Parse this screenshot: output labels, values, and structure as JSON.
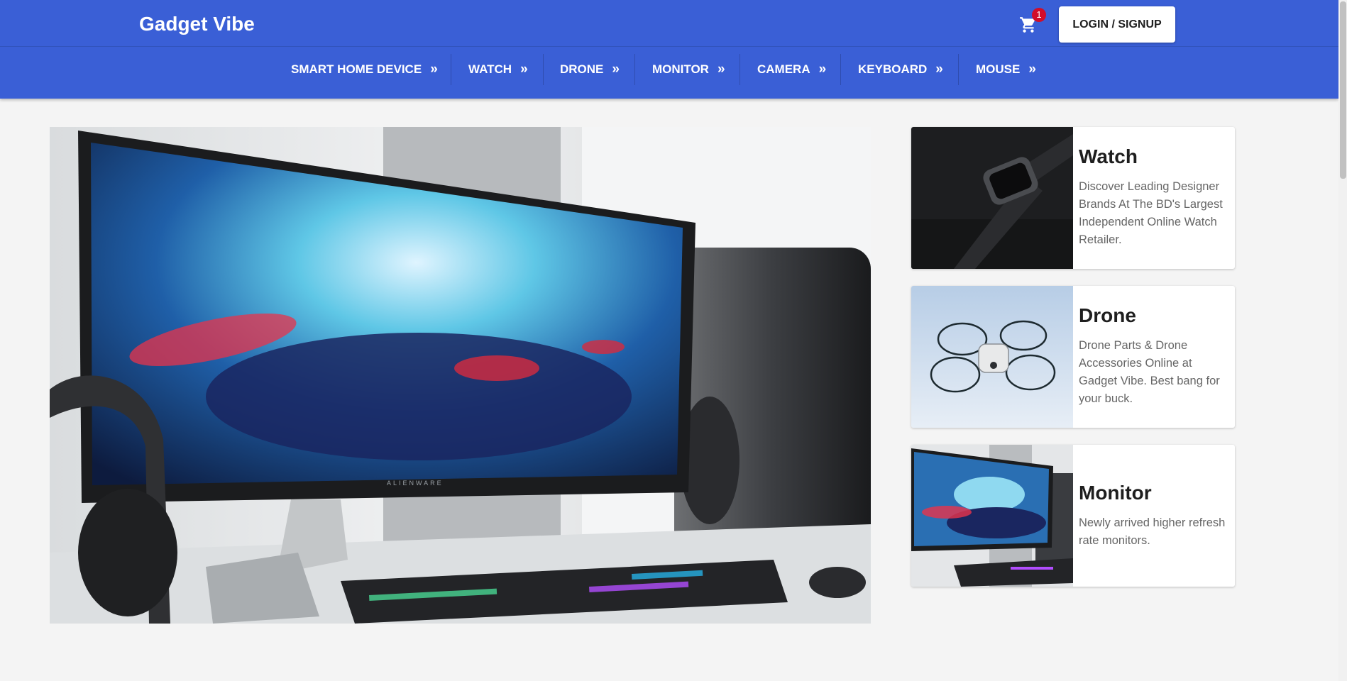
{
  "brand": "Gadget Vibe",
  "cart": {
    "icon": "shopping-cart-icon",
    "count": "1"
  },
  "login_label": "LOGIN / SIGNUP",
  "nav": [
    {
      "label": "SMART HOME DEVICE",
      "chevron": "»"
    },
    {
      "label": "WATCH",
      "chevron": "»"
    },
    {
      "label": "DRONE",
      "chevron": "»"
    },
    {
      "label": "MONITOR",
      "chevron": "»"
    },
    {
      "label": "CAMERA",
      "chevron": "»"
    },
    {
      "label": "KEYBOARD",
      "chevron": "»"
    },
    {
      "label": "MOUSE",
      "chevron": "»"
    }
  ],
  "hero": {
    "monitor_brand": "ALIENWARE"
  },
  "cards": [
    {
      "title": "Watch",
      "text": "Discover Leading Designer Brands At The BD's Largest Independent Online Watch Retailer."
    },
    {
      "title": "Drone",
      "text": "Drone Parts & Drone Accessories Online at Gadget Vibe. Best bang for your buck."
    },
    {
      "title": "Monitor",
      "text": "Newly arrived higher refresh rate monitors."
    }
  ],
  "colors": {
    "header": "#3a5fd6",
    "badge": "#d10d2a",
    "page": "#f4f4f4"
  }
}
